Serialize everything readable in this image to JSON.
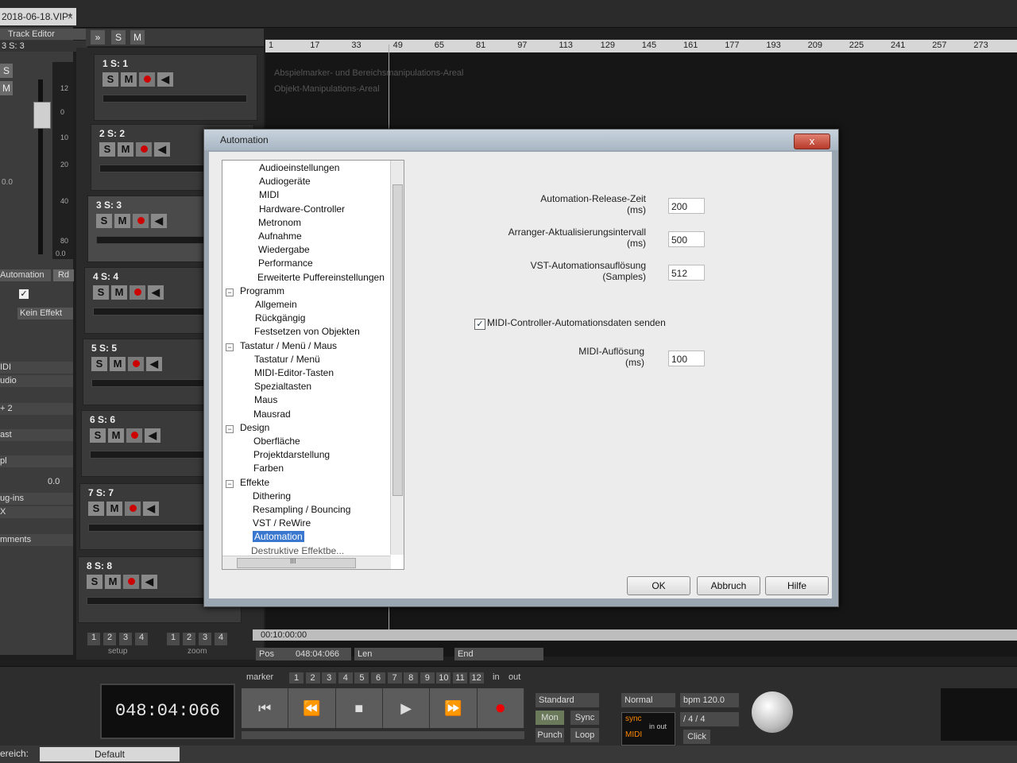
{
  "project_tab": {
    "label": "2018-06-18.VIP*",
    "close": "×"
  },
  "inspector": {
    "header": "Track Editor",
    "sub": "3   S: 3",
    "buttons": [
      "S",
      "M"
    ],
    "meter_labels": [
      "12",
      "0",
      "10",
      "20",
      "40",
      "80",
      "0.0"
    ],
    "pan_value": "0.0",
    "automation_label": "Automation",
    "automation_mode": "Rd",
    "effect_label": "Kein Effekt",
    "side_labels": [
      "IDI",
      "udio",
      "+ 2",
      "ast",
      "pl",
      "ug-ins",
      "X",
      "mments"
    ],
    "value_00": "0.0"
  },
  "track_toolbar": {
    "collapse": "»",
    "solo": "S",
    "mute": "M"
  },
  "tracks": [
    {
      "name": "1    S: 1"
    },
    {
      "name": "2    S: 2"
    },
    {
      "name": "3    S: 3"
    },
    {
      "name": "4    S: 4"
    },
    {
      "name": "5    S: 5"
    },
    {
      "name": "6    S: 6"
    },
    {
      "name": "7    S: 7"
    },
    {
      "name": "8    S: 8"
    }
  ],
  "track_buttons": {
    "solo": "S",
    "mute": "M"
  },
  "ruler": [
    "1",
    "17",
    "33",
    "49",
    "65",
    "81",
    "97",
    "113",
    "129",
    "145",
    "161",
    "177",
    "193",
    "209",
    "225",
    "241",
    "257",
    "273"
  ],
  "arrange": {
    "hint1": "Abspielmarker- und Bereichsmanipulations-Areal",
    "hint2": "Objekt-Manipulations-Areal"
  },
  "setup_zoom": {
    "setup_nums": [
      "1",
      "2",
      "3",
      "4"
    ],
    "setup_label": "setup",
    "zoom_nums": [
      "1",
      "2",
      "3",
      "4"
    ],
    "zoom_label": "zoom"
  },
  "timebar": {
    "time": "00:10:00:00"
  },
  "posbar": {
    "pos_label": "Pos",
    "pos_value": "048:04:066",
    "len_label": "Len",
    "end_label": "End"
  },
  "transport": {
    "clock": "048:04:066",
    "marker_label": "marker",
    "marker_nums": [
      "1",
      "2",
      "3",
      "4",
      "5",
      "6",
      "7",
      "8",
      "9",
      "10",
      "11",
      "12"
    ],
    "in_label": "in",
    "out_label": "out",
    "mode": "Standard",
    "mon": "Mon",
    "sync": "Sync",
    "punch": "Punch",
    "loop": "Loop",
    "normal": "Normal",
    "bpm": "bpm 120.0",
    "signature": "/  4 / 4",
    "click": "Click",
    "sync_label": "sync",
    "midi_label": "MIDI",
    "inout": "in out"
  },
  "statusbar": {
    "left_text": "ereich:",
    "default": "Default"
  },
  "dialog": {
    "title": "Automation",
    "close": "x",
    "tree": [
      {
        "label": "Audioeinstellungen",
        "level": 3
      },
      {
        "label": "Audiogeräte",
        "level": 3
      },
      {
        "label": "MIDI",
        "level": 3
      },
      {
        "label": "Hardware-Controller",
        "level": 3
      },
      {
        "label": "Metronom",
        "level": 3
      },
      {
        "label": "Aufnahme",
        "level": 3
      },
      {
        "label": "Wiedergabe",
        "level": 3
      },
      {
        "label": "Performance",
        "level": 3
      },
      {
        "label": "Erweiterte Puffereinstellungen",
        "level": 3
      },
      {
        "label": "Programm",
        "level": 1,
        "toggle": "−"
      },
      {
        "label": "Allgemein",
        "level": 2
      },
      {
        "label": "Rückgängig",
        "level": 2
      },
      {
        "label": "Festsetzen von Objekten",
        "level": 2
      },
      {
        "label": "Tastatur / Menü / Maus",
        "level": 1,
        "toggle": "−"
      },
      {
        "label": "Tastatur / Menü",
        "level": 2
      },
      {
        "label": "MIDI-Editor-Tasten",
        "level": 2
      },
      {
        "label": "Spezialtasten",
        "level": 2
      },
      {
        "label": "Maus",
        "level": 2
      },
      {
        "label": "Mausrad",
        "level": 2
      },
      {
        "label": "Design",
        "level": 1,
        "toggle": "−"
      },
      {
        "label": "Oberfläche",
        "level": 2
      },
      {
        "label": "Projektdarstellung",
        "level": 2
      },
      {
        "label": "Farben",
        "level": 2
      },
      {
        "label": "Effekte",
        "level": 1,
        "toggle": "−"
      },
      {
        "label": "Dithering",
        "level": 2
      },
      {
        "label": "Resampling / Bouncing",
        "level": 2
      },
      {
        "label": "VST / ReWire",
        "level": 2
      },
      {
        "label": "Automation",
        "level": 2,
        "selected": true
      }
    ],
    "tree_cut_off": "Destruktive Effektbe...",
    "fields": {
      "release_label_1": "Automation-Release-Zeit",
      "release_label_2": "(ms)",
      "release_value": "200",
      "arranger_label_1": "Arranger-Aktualisierungsintervall",
      "arranger_label_2": "(ms)",
      "arranger_value": "500",
      "vst_label_1": "VST-Automationsauflösung",
      "vst_label_2": "(Samples)",
      "vst_value": "512",
      "midi_send_label": "MIDI-Controller-Automationsdaten senden",
      "midi_send_checked": true,
      "midi_res_label_1": "MIDI-Auflösung",
      "midi_res_label_2": "(ms)",
      "midi_res_value": "100"
    },
    "buttons": {
      "ok": "OK",
      "cancel": "Abbruch",
      "help": "Hilfe"
    },
    "hscroll_label": "III"
  }
}
